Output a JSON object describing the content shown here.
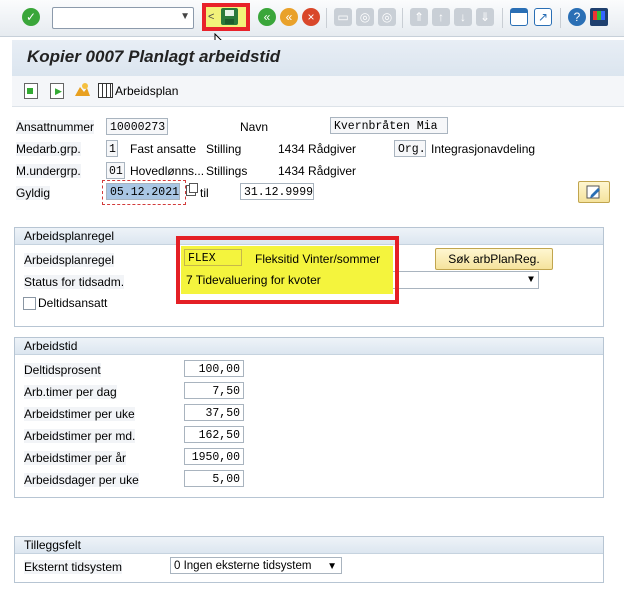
{
  "toolbar": {
    "icons": [
      "enter-icon",
      "save-icon",
      "back-icon",
      "exit-icon",
      "cancel-icon",
      "print-icon",
      "find-icon",
      "find-next-icon",
      "first-page-icon",
      "prev-page-icon",
      "next-page-icon",
      "last-page-icon",
      "create-session-icon",
      "shortcut-icon",
      "help-icon",
      "customize-layout-icon"
    ],
    "back_char": "<",
    "help_char": "?"
  },
  "title": "Kopier 0007 Planlagt arbeidstid",
  "app_toolbar": {
    "arbeidsplan_label": "Arbeidsplan"
  },
  "header": {
    "ansattnummer_label": "Ansattnummer",
    "ansattnummer_value": "10000273",
    "navn_label": "Navn",
    "navn_value": "Kvernbråten Mia",
    "medarb_label": "Medarb.grp.",
    "medarb_value": "1",
    "medarb_text": "Fast ansatte",
    "stilling_label": "Stilling",
    "stilling_value": "1434 Rådgiver",
    "org_label": "Org.",
    "org_value": "Integrasjonavdeling",
    "mundergrp_label": "M.undergrp.",
    "mundergrp_value": "01",
    "mundergrp_text": "Hovedlønns...",
    "stillings_label": "Stillings",
    "stillings_value": "1434 Rådgiver",
    "gyldig_label": "Gyldig",
    "gyldig_from": "05.12.2021",
    "til_label": "til",
    "gyldig_to": "31.12.9999"
  },
  "arbeidsplanregel": {
    "group_title": "Arbeidsplanregel",
    "regel_label": "Arbeidsplanregel",
    "regel_value": "FLEX",
    "regel_text": "Fleksitid Vinter/sommer",
    "search_button": "Søk arbPlanReg.",
    "status_label": "Status for tidsadm.",
    "status_value": "7 Tidevaluering for kvoter",
    "deltid_label": "Deltidsansatt"
  },
  "arbeidstid": {
    "group_title": "Arbeidstid",
    "rows": [
      {
        "label": "Deltidsprosent",
        "value": "100,00"
      },
      {
        "label": "Arb.timer per dag",
        "value": "7,50"
      },
      {
        "label": "Arbeidstimer per uke",
        "value": "37,50"
      },
      {
        "label": "Arbeidstimer per md.",
        "value": "162,50"
      },
      {
        "label": "Arbeidstimer per år",
        "value": "1950,00"
      },
      {
        "label": "Arbeidsdager per uke",
        "value": "5,00"
      }
    ]
  },
  "tilleggsfelt": {
    "group_title": "Tilleggsfelt",
    "tidsystem_label": "Eksternt tidsystem",
    "tidsystem_value": "0 Ingen eksterne tidsystem"
  },
  "colors": {
    "highlight_red": "#e41f25",
    "highlight_yellow": "#f4f43d",
    "sap_blue": "#2a6fb5"
  }
}
